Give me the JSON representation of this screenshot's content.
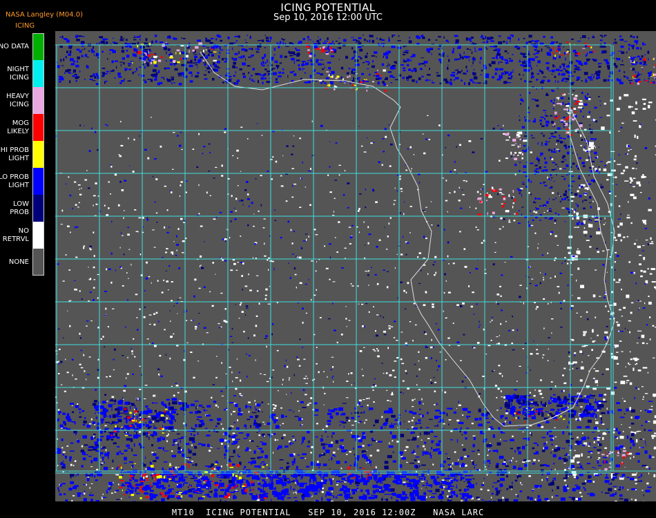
{
  "header": {
    "title": "ICING POTENTIAL",
    "subtitle": "Sep 10, 2016 12:00 UTC",
    "org": "NASA Langley (M04.0)",
    "product": "ICING"
  },
  "legend": [
    {
      "label": "NO DATA",
      "color": "#00b000"
    },
    {
      "label": "NIGHT\nICING",
      "color": "#00f0f0"
    },
    {
      "label": "HEAVY\nICING",
      "color": "#e8a8e0"
    },
    {
      "label": "MOG\nLIKELY",
      "color": "#ff0000"
    },
    {
      "label": "HI PROB\nLIGHT",
      "color": "#ffff00"
    },
    {
      "label": "LO PROB\nLIGHT",
      "color": "#0000ff"
    },
    {
      "label": "LOW\nPROB",
      "color": "#00007a"
    },
    {
      "label": "NO\nRETRVL",
      "color": "#ffffff"
    },
    {
      "label": "NONE",
      "color": "#555555"
    }
  ],
  "colors": {
    "background": "#555555",
    "grid": "#40e0e0",
    "coast": "#e0e0e0",
    "grid_label": "#c03030"
  },
  "footer": "MT10  ICING POTENTIAL   SEP 10, 2016 12:00Z   NASA LARC"
}
